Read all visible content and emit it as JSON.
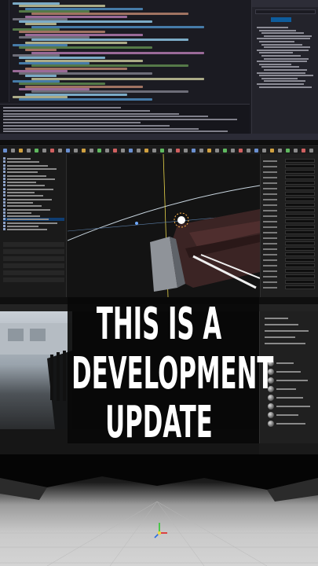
{
  "overlay_title": {
    "line1": "THIS IS A",
    "line2": "DEVELOPMENT",
    "line3": "UPDATE"
  },
  "colors": {
    "editor_bg": "#1b1b22",
    "solution_panel_bg": "#23232b",
    "unreal_bg": "#151515",
    "selection_blue": "#0f3e73",
    "accent_blue": "#0e5c9c",
    "gizmo_red": "#e02020",
    "gizmo_green": "#2ec82e",
    "gizmo_blue": "#2a6ce0",
    "overlay_text": "#ffffff"
  },
  "icons": {
    "transform_gizmo": "transform-gizmo-icon",
    "light_source": "point-light-icon",
    "material_balls": "material-preview-sphere-icon"
  }
}
